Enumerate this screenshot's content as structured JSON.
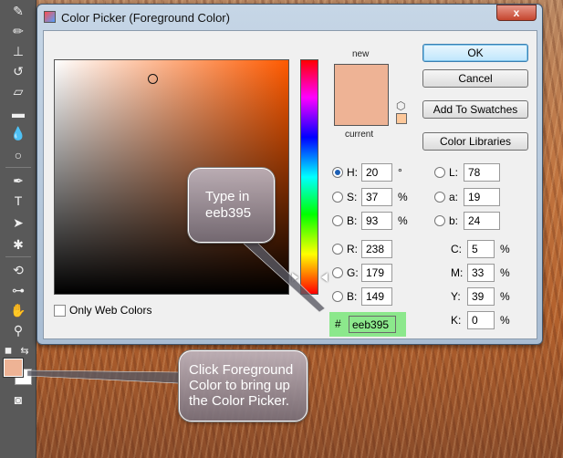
{
  "dialog": {
    "title": "Color Picker (Foreground Color)",
    "close_label": "x",
    "new_label": "new",
    "current_label": "current",
    "only_web_colors_label": "Only Web Colors",
    "gamut_icon": "cube-icon"
  },
  "buttons": {
    "ok": "OK",
    "cancel": "Cancel",
    "add_to_swatches": "Add To Swatches",
    "color_libraries": "Color Libraries"
  },
  "fields": {
    "h": {
      "label": "H:",
      "value": "20",
      "unit": "°",
      "selected": true
    },
    "s": {
      "label": "S:",
      "value": "37",
      "unit": "%"
    },
    "b": {
      "label": "B:",
      "value": "93",
      "unit": "%"
    },
    "r": {
      "label": "R:",
      "value": "238"
    },
    "g": {
      "label": "G:",
      "value": "179"
    },
    "b2": {
      "label": "B:",
      "value": "149"
    },
    "l": {
      "label": "L:",
      "value": "78"
    },
    "a": {
      "label": "a:",
      "value": "19"
    },
    "b3": {
      "label": "b:",
      "value": "24"
    },
    "c": {
      "label": "C:",
      "value": "5",
      "unit": "%"
    },
    "m": {
      "label": "M:",
      "value": "33",
      "unit": "%"
    },
    "y": {
      "label": "Y:",
      "value": "39",
      "unit": "%"
    },
    "k": {
      "label": "K:",
      "value": "0",
      "unit": "%"
    },
    "hex": {
      "label": "#",
      "value": "eeb395"
    }
  },
  "colors": {
    "selected": "#eeb395",
    "field_hue": "#ff5a00",
    "highlight": "#8ce88c"
  },
  "callouts": {
    "type_in": [
      "Type in",
      "eeb395"
    ],
    "click_fg": [
      "Click Foreground",
      "Color to bring up",
      "the Color Picker."
    ]
  },
  "toolbar": {
    "tools": [
      "brush-icon",
      "pencil-icon",
      "stamp-icon",
      "history-brush-icon",
      "eraser-icon",
      "gradient-icon",
      "blur-icon",
      "dodge-icon",
      "pen-icon",
      "type-icon",
      "path-select-icon",
      "shape-icon",
      "3d-rotate-icon",
      "3d-camera-icon",
      "hand-icon",
      "zoom-icon"
    ]
  }
}
